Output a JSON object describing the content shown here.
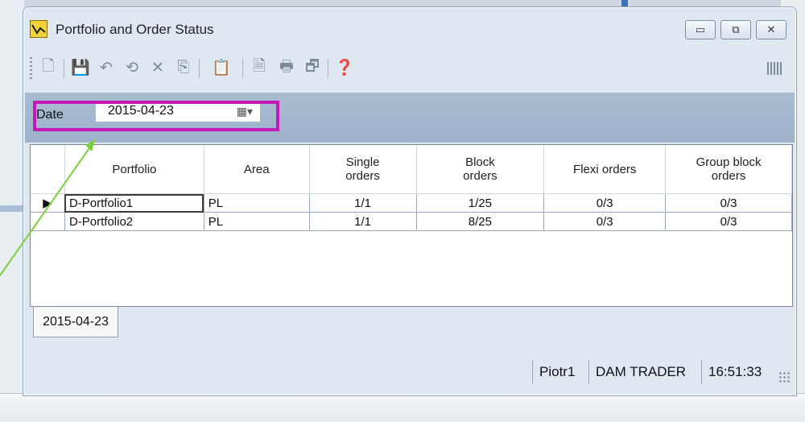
{
  "window": {
    "title": "Portfolio and Order Status",
    "controls": {
      "minimize": "▭",
      "maximize": "⧉",
      "close": "✕"
    }
  },
  "toolbar": {
    "buttons": [
      {
        "name": "new-icon",
        "glyph": "🗋"
      },
      {
        "name": "save-icon",
        "glyph": "💾"
      },
      {
        "name": "undo-icon",
        "glyph": "↶"
      },
      {
        "name": "refresh-icon",
        "glyph": "⟲"
      },
      {
        "name": "delete-icon",
        "glyph": "✕"
      },
      {
        "name": "copy-icon",
        "glyph": "⎘"
      },
      {
        "name": "paste-icon",
        "glyph": "📋"
      },
      {
        "name": "export-icon",
        "glyph": "🗎"
      },
      {
        "name": "print-icon",
        "glyph": "🖶"
      },
      {
        "name": "import-icon",
        "glyph": "🗗"
      },
      {
        "name": "help-icon",
        "glyph": "❓"
      }
    ]
  },
  "filter": {
    "date_label": "Date",
    "date_value": "2015-04-23",
    "calendar_glyph": "▦▾"
  },
  "grid": {
    "columns": [
      "Portfolio",
      "Area",
      "Single\norders",
      "Block\norders",
      "Flexi orders",
      "Group block\norders"
    ],
    "rows": [
      {
        "portfolio": "D-Portfolio1",
        "area": "PL",
        "single": "1/1",
        "block": "1/25",
        "flexi": "0/3",
        "group": "0/3",
        "selected": true
      },
      {
        "portfolio": "D-Portfolio2",
        "area": "PL",
        "single": "1/1",
        "block": "8/25",
        "flexi": "0/3",
        "group": "0/3",
        "selected": false
      }
    ]
  },
  "tabs": {
    "active": "2015-04-23"
  },
  "status": {
    "user": "Piotr1",
    "role": "DAM TRADER",
    "time": "16:51:33"
  },
  "colors": {
    "highlight": "#c418b8",
    "arrow": "#7ccf3a"
  }
}
